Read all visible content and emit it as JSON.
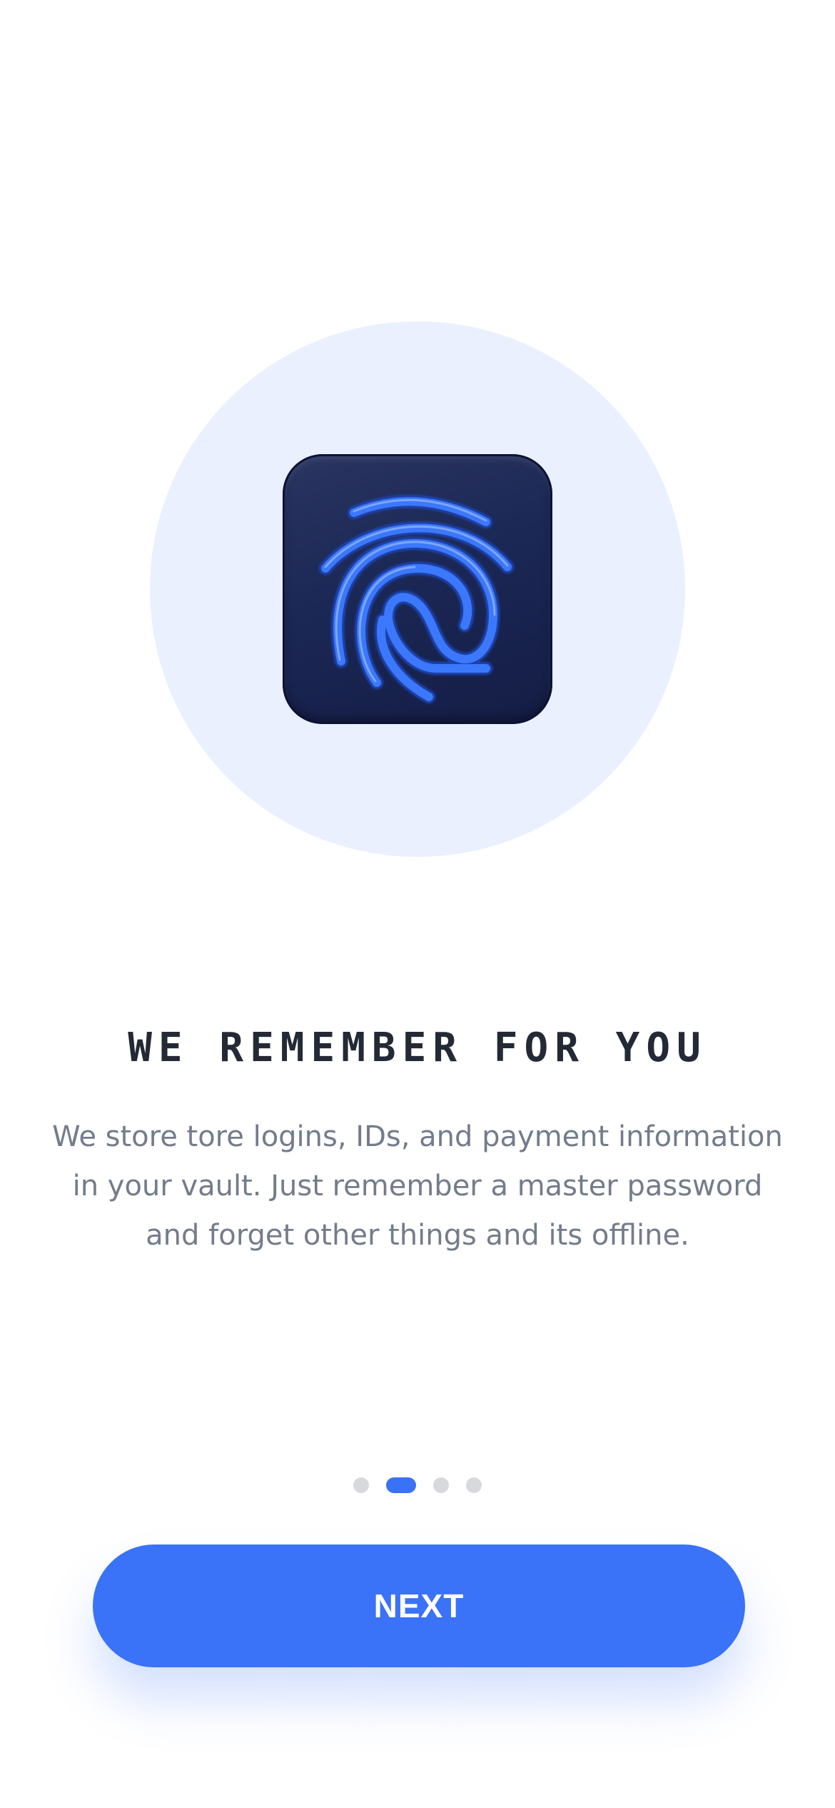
{
  "onboarding": {
    "illustration": {
      "icon": "fingerprint-icon",
      "circle_color": "#eaf0fd",
      "tile_color": "#1b2755",
      "print_color": "#3b78fb"
    },
    "headline": "WE REMEMBER FOR YOU",
    "description": "We store tore logins, IDs, and payment information in your vault. Just remember a master password and forget other things and its offline.",
    "pager": {
      "total": 4,
      "current": 2
    },
    "next_button": {
      "label": "NEXT",
      "color": "#3a72f8"
    }
  }
}
